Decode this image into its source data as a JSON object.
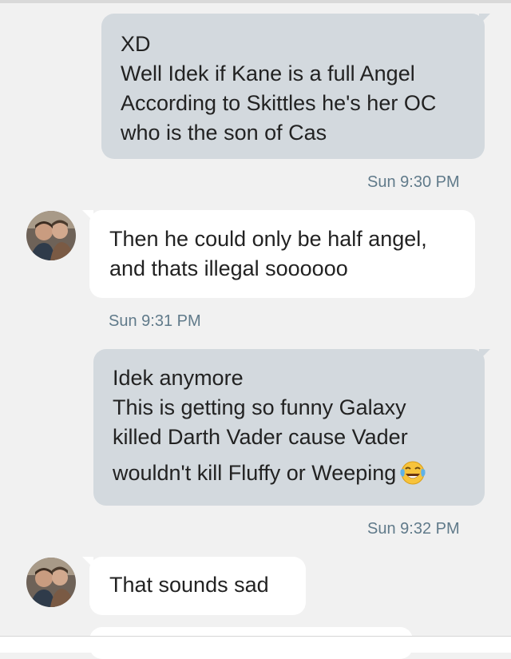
{
  "messages": [
    {
      "direction": "outgoing",
      "lines": [
        "XD",
        "Well Idek if Kane is a full Angel",
        "According to Skittles he's her OC",
        "who is the son of Cas"
      ],
      "time": "Sun 9:30 PM"
    },
    {
      "direction": "incoming",
      "lines": [
        "Then he could only be half angel,",
        "and thats illegal soooooo"
      ],
      "time": "Sun 9:31 PM"
    },
    {
      "direction": "outgoing",
      "lines": [
        "Idek anymore",
        "This is getting so funny Galaxy",
        "killed Darth Vader cause Vader",
        "wouldn't kill Fluffy or Weeping"
      ],
      "emoji": "face-with-tears-of-joy-icon",
      "time": "Sun 9:32 PM"
    },
    {
      "direction": "incoming",
      "lines": [
        "That sounds sad"
      ]
    }
  ],
  "colors": {
    "background": "#f1f1f1",
    "outgoing_bubble": "#d3d9de",
    "incoming_bubble": "#ffffff",
    "timestamp": "#607a8a",
    "text": "#222222"
  }
}
